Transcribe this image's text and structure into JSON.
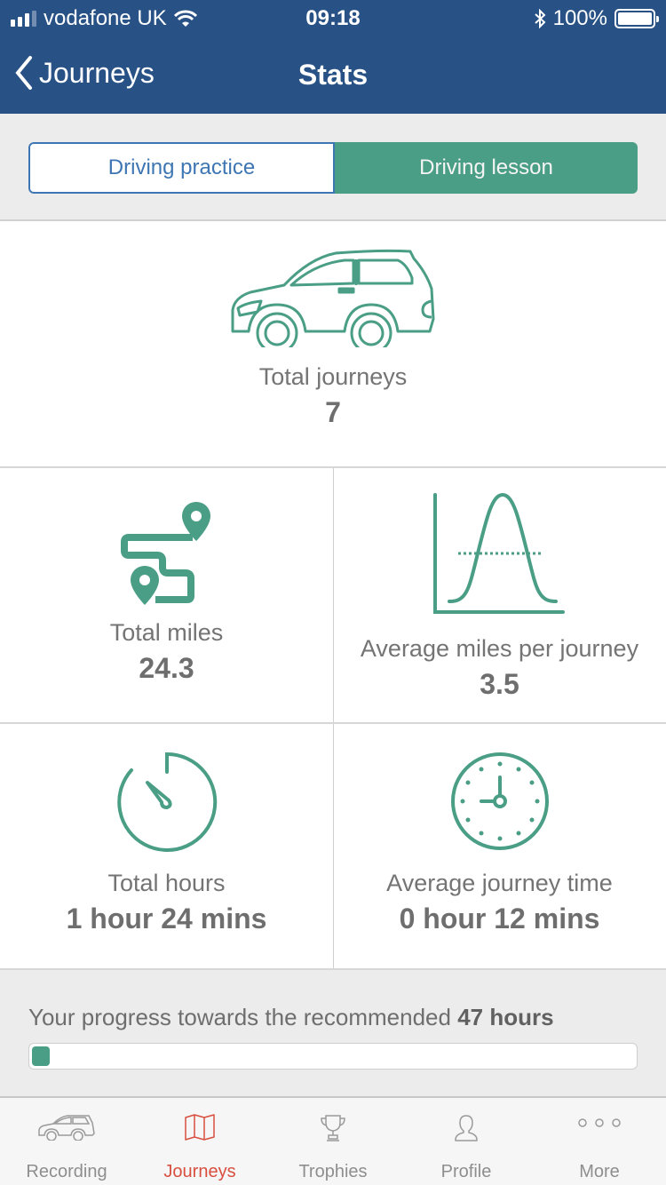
{
  "status_bar": {
    "carrier": "vodafone UK",
    "time": "09:18",
    "battery_percent": "100%",
    "signal_bars": 3,
    "signal_bars_total": 4
  },
  "nav": {
    "back_label": "Journeys",
    "title": "Stats"
  },
  "segments": {
    "options": [
      {
        "label": "Driving practice",
        "selected": false
      },
      {
        "label": "Driving lesson",
        "selected": true
      }
    ]
  },
  "stats": {
    "total_journeys": {
      "label": "Total journeys",
      "value": "7",
      "icon": "car-icon"
    },
    "total_miles": {
      "label": "Total miles",
      "value": "24.3",
      "icon": "route-map-icon"
    },
    "avg_miles": {
      "label": "Average miles per journey",
      "value": "3.5",
      "icon": "bell-curve-icon"
    },
    "total_hours": {
      "label": "Total hours",
      "value": "1 hour 24 mins",
      "icon": "stopwatch-icon"
    },
    "avg_time": {
      "label": "Average journey time",
      "value": "0 hour 12 mins",
      "icon": "clock-icon"
    }
  },
  "progress": {
    "text_prefix": "Your progress towards the recommended ",
    "target": "47 hours",
    "fraction": 0.03
  },
  "tabbar": {
    "items": [
      {
        "label": "Recording",
        "icon": "car-icon",
        "active": false
      },
      {
        "label": "Journeys",
        "icon": "map-icon",
        "active": true
      },
      {
        "label": "Trophies",
        "icon": "trophy-icon",
        "active": false
      },
      {
        "label": "Profile",
        "icon": "person-icon",
        "active": false
      },
      {
        "label": "More",
        "icon": "more-dots-icon",
        "active": false
      }
    ]
  },
  "colors": {
    "nav_bg": "#285286",
    "accent_green": "#4a9e85",
    "segment_blue": "#3d76b2",
    "tab_active": "#d84f40"
  }
}
